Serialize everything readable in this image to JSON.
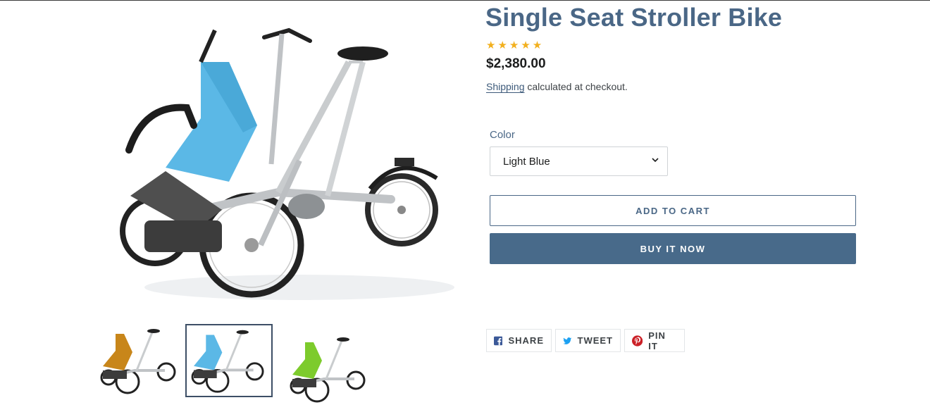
{
  "product": {
    "title": "Single Seat Stroller Bike",
    "rating_stars": "★★★★★",
    "rating_value": 5,
    "price": "$2,380.00",
    "shipping_link": "Shipping",
    "shipping_text": " calculated at checkout."
  },
  "variant": {
    "label": "Color",
    "selected": "Light Blue"
  },
  "actions": {
    "add_to_cart": "ADD TO CART",
    "buy_now": "BUY IT NOW"
  },
  "share": {
    "facebook": "SHARE",
    "twitter": "TWEET",
    "pinterest": "PIN IT"
  },
  "gallery": {
    "seat_colors": [
      "#c8861a",
      "#5bb8e6",
      "#7dcb2c"
    ],
    "selected_index": 1
  },
  "colors": {
    "title": "#4a6786",
    "accent": "#486a8a",
    "star": "#f2b01e",
    "facebook": "#3b5998",
    "twitter": "#1da1f2",
    "pinterest": "#cb2027"
  }
}
